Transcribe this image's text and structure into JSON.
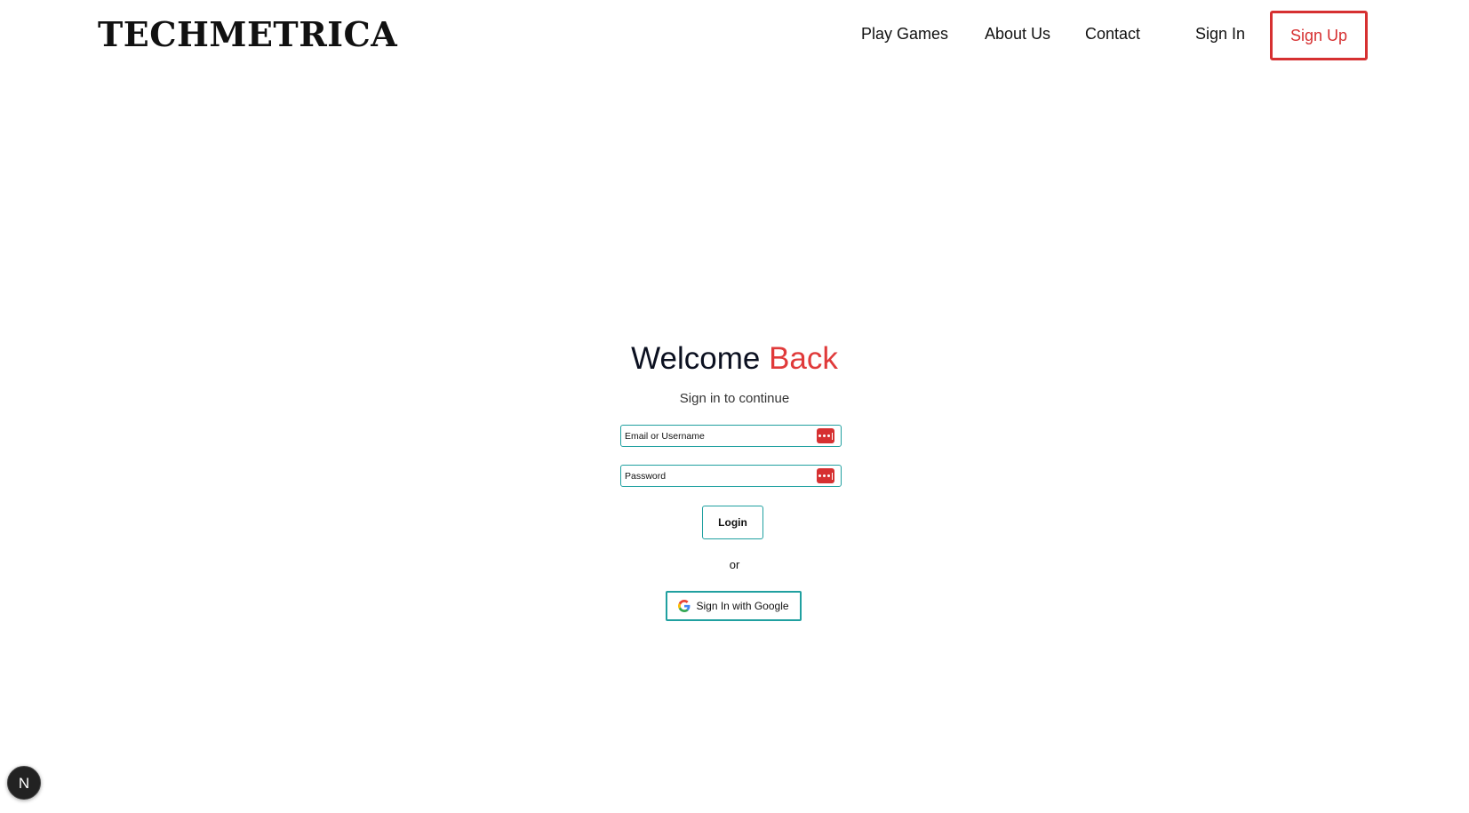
{
  "header": {
    "logo": "TECHMETRICA",
    "nav": {
      "play_games": "Play Games",
      "about_us": "About Us",
      "contact": "Contact",
      "sign_in": "Sign In",
      "sign_up": "Sign Up"
    }
  },
  "main": {
    "title_prefix": "Welcome",
    "title_accent": "Back",
    "subtitle": "Sign in to continue",
    "email_field": {
      "placeholder": "Email or Username",
      "value": ""
    },
    "password_field": {
      "placeholder": "Password",
      "value": ""
    },
    "login_label": "Login",
    "or_text": "or",
    "google_label": "Sign In with Google"
  },
  "dev_badge": {
    "letter": "N"
  },
  "colors": {
    "accent": "#e03a3a",
    "signup_border": "#d63031",
    "field_border": "#20a0a0",
    "password_manager_icon": "#d63031"
  },
  "icons": {
    "password_manager": "password-manager-icon",
    "google": "google-icon"
  }
}
